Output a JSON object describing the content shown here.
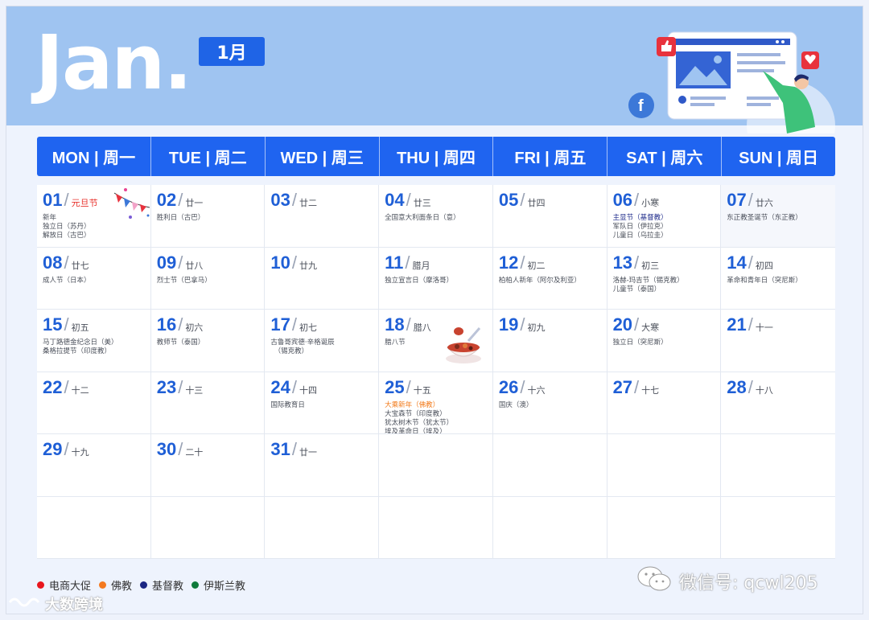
{
  "banner": {
    "title": "Jan.",
    "month_badge": "1月"
  },
  "weekdays": [
    "MON | 周一",
    "TUE | 周二",
    "WED | 周三",
    "THU | 周四",
    "FRI | 周五",
    "SAT | 周六",
    "SUN | 周日"
  ],
  "days": [
    {
      "num": "01",
      "lunar": "元旦节",
      "lunar_color": "red",
      "events": [
        {
          "text": "新年"
        },
        {
          "text": "独立日（苏丹）"
        },
        {
          "text": "解放日（古巴）"
        }
      ]
    },
    {
      "num": "02",
      "lunar": "廿一",
      "events": [
        {
          "text": "胜利日（古巴）"
        }
      ]
    },
    {
      "num": "03",
      "lunar": "廿二",
      "events": []
    },
    {
      "num": "04",
      "lunar": "廿三",
      "events": [
        {
          "text": "全国意大利面条日（意）"
        }
      ]
    },
    {
      "num": "05",
      "lunar": "廿四",
      "events": []
    },
    {
      "num": "06",
      "lunar": "小寒",
      "events": [
        {
          "text": "主显节（基督教）",
          "color": "blue"
        },
        {
          "text": "军队日（伊拉克）"
        },
        {
          "text": "儿童日（乌拉圭）"
        }
      ]
    },
    {
      "num": "07",
      "lunar": "廿六",
      "events": [
        {
          "text": "东正教圣诞节（东正教）"
        }
      ]
    },
    {
      "num": "08",
      "lunar": "廿七",
      "events": [
        {
          "text": "成人节（日本）"
        }
      ]
    },
    {
      "num": "09",
      "lunar": "廿八",
      "events": [
        {
          "text": "烈士节（巴拿马）"
        }
      ]
    },
    {
      "num": "10",
      "lunar": "廿九",
      "events": []
    },
    {
      "num": "11",
      "lunar": "腊月",
      "events": [
        {
          "text": "独立宣言日（摩洛哥）"
        }
      ]
    },
    {
      "num": "12",
      "lunar": "初二",
      "events": [
        {
          "text": "柏柏人新年（阿尔及利亚）"
        }
      ]
    },
    {
      "num": "13",
      "lunar": "初三",
      "events": [
        {
          "text": "洛赫-玛吉节（锡克教）"
        },
        {
          "text": "儿童节（泰国）"
        }
      ]
    },
    {
      "num": "14",
      "lunar": "初四",
      "events": [
        {
          "text": "革命和青年日（突尼斯）"
        }
      ]
    },
    {
      "num": "15",
      "lunar": "初五",
      "events": [
        {
          "text": "马丁路德金纪念日（美）"
        },
        {
          "text": "桑格拉提节（印度教）"
        }
      ]
    },
    {
      "num": "16",
      "lunar": "初六",
      "events": [
        {
          "text": "教师节（泰国）"
        }
      ]
    },
    {
      "num": "17",
      "lunar": "初七",
      "events": [
        {
          "text": "古鲁哥宾德·辛格诞辰"
        },
        {
          "text": "　（锡克教）"
        }
      ]
    },
    {
      "num": "18",
      "lunar": "腊八",
      "events": [
        {
          "text": "腊八节"
        }
      ]
    },
    {
      "num": "19",
      "lunar": "初九",
      "events": []
    },
    {
      "num": "20",
      "lunar": "大寒",
      "events": [
        {
          "text": "独立日（突尼斯）"
        }
      ]
    },
    {
      "num": "21",
      "lunar": "十一",
      "events": []
    },
    {
      "num": "22",
      "lunar": "十二",
      "events": []
    },
    {
      "num": "23",
      "lunar": "十三",
      "events": []
    },
    {
      "num": "24",
      "lunar": "十四",
      "events": [
        {
          "text": "国际教育日"
        }
      ]
    },
    {
      "num": "25",
      "lunar": "十五",
      "events": [
        {
          "text": "大乘新年（佛教）",
          "color": "orange"
        },
        {
          "text": "大宝森节（印度教）"
        },
        {
          "text": "犹太树木节（犹太节）"
        },
        {
          "text": "埃及革命日（埃及）"
        }
      ]
    },
    {
      "num": "26",
      "lunar": "十六",
      "events": [
        {
          "text": "国庆（澳）"
        }
      ]
    },
    {
      "num": "27",
      "lunar": "十七",
      "events": []
    },
    {
      "num": "28",
      "lunar": "十八",
      "events": []
    },
    {
      "num": "29",
      "lunar": "十九",
      "events": []
    },
    {
      "num": "30",
      "lunar": "二十",
      "events": []
    },
    {
      "num": "31",
      "lunar": "廿一",
      "events": []
    }
  ],
  "legend": [
    {
      "label": "电商大促",
      "color": "#e8161d"
    },
    {
      "label": "佛教",
      "color": "#f47a1f"
    },
    {
      "label": "基督教",
      "color": "#1b2683"
    },
    {
      "label": "伊斯兰教",
      "color": "#0f7a3a"
    }
  ],
  "watermarks": {
    "left": "大数跨境",
    "right": "微信号: qcwl205"
  }
}
